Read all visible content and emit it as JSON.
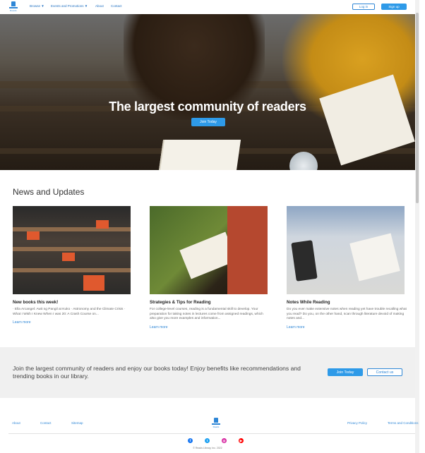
{
  "brand": {
    "logo_text": "Reads",
    "logo_color": "#2e86d6"
  },
  "nav": {
    "items": [
      {
        "label": "Browse ▼"
      },
      {
        "label": "Events and Promotions ▼"
      },
      {
        "label": "About"
      },
      {
        "label": "Contact"
      }
    ],
    "login_label": "Log in",
    "signup_label": "Sign up"
  },
  "hero": {
    "title": "The largest community of readers",
    "button_label": "Join Today"
  },
  "news": {
    "title": "News and Updates",
    "cards": [
      {
        "title": "New books this week!",
        "text": "· Ella Arcangel: Awit ng Pangil at Kuko · Astronomy and the Climate Crisis · What I Wish I Knew When I was 20: A Crash Course on...",
        "link": "Learn more"
      },
      {
        "title": "Strategies & Tips for Reading",
        "text": "For college-level courses, reading is a fundamental skill to develop. Your preparation for taking notes in lectures come from assigned readings, which also give you more examples and information...",
        "link": "Learn more"
      },
      {
        "title": "Notes While Reading",
        "text": "Do you ever make extensive notes when reading yet have trouble recalling what you read? Do you, on the other hand, scan through literature devoid of making notes and...",
        "link": "Learn more"
      }
    ]
  },
  "cta": {
    "text": "Join the largest community of readers and enjoy our books today! Enjoy benefits like recommendations and trending books in our library.",
    "join_label": "Join Today",
    "contact_label": "Contact us"
  },
  "footer": {
    "links_left": [
      "About",
      "Contact",
      "Sitemap"
    ],
    "links_right": [
      "Privacy Policy",
      "Terms and Conditions"
    ],
    "social": [
      {
        "icon": "facebook-icon",
        "glyph": "f",
        "color": "#1877f2"
      },
      {
        "icon": "twitter-icon",
        "glyph": "t",
        "color": "#1da1f2"
      },
      {
        "icon": "instagram-icon",
        "glyph": "◎",
        "color": "#d6249f"
      },
      {
        "icon": "youtube-icon",
        "glyph": "▶",
        "color": "#ff0000"
      }
    ],
    "copyright": "© Reads Library, Inc. 2022"
  },
  "colors": {
    "accent": "#2e9ae8",
    "link": "#2e86d6",
    "cta_background": "#f0f0f0"
  }
}
